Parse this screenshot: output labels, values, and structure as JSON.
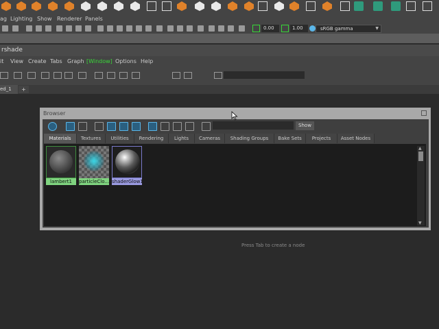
{
  "main_menu": [
    "ag",
    "Lighting",
    "Show",
    "Renderer",
    "Panels"
  ],
  "toolbar": {
    "field1": "0.00",
    "field2": "1.00",
    "colorspace": "sRGB gamma"
  },
  "hypershade": {
    "title": "rshade",
    "menu": [
      "it",
      "View",
      "Create",
      "Tabs",
      "Graph",
      "[Window]",
      "Options",
      "Help"
    ],
    "graph_tab": "ed_1",
    "add_tab": "+",
    "hint": "Press Tab to create a node"
  },
  "browser": {
    "title": "Browser",
    "show_button": "Show",
    "tabs": [
      "Materials",
      "Textures",
      "Utilities",
      "Rendering",
      "Lights",
      "Cameras",
      "Shading Groups",
      "Bake Sets",
      "Projects",
      "Asset Nodes"
    ],
    "active_tab": "Materials",
    "swatches": [
      {
        "label": "lambert1",
        "label_color": "#7fd37f"
      },
      {
        "label": "particleClo...",
        "label_color": "#7fd37f"
      },
      {
        "label": "shaderGlow1",
        "label_color": "#9a9ae0"
      }
    ]
  },
  "colors": {
    "accent_green": "#38d838",
    "accent_orange": "#e0822a",
    "selection_blue": "#5bb6e8"
  }
}
